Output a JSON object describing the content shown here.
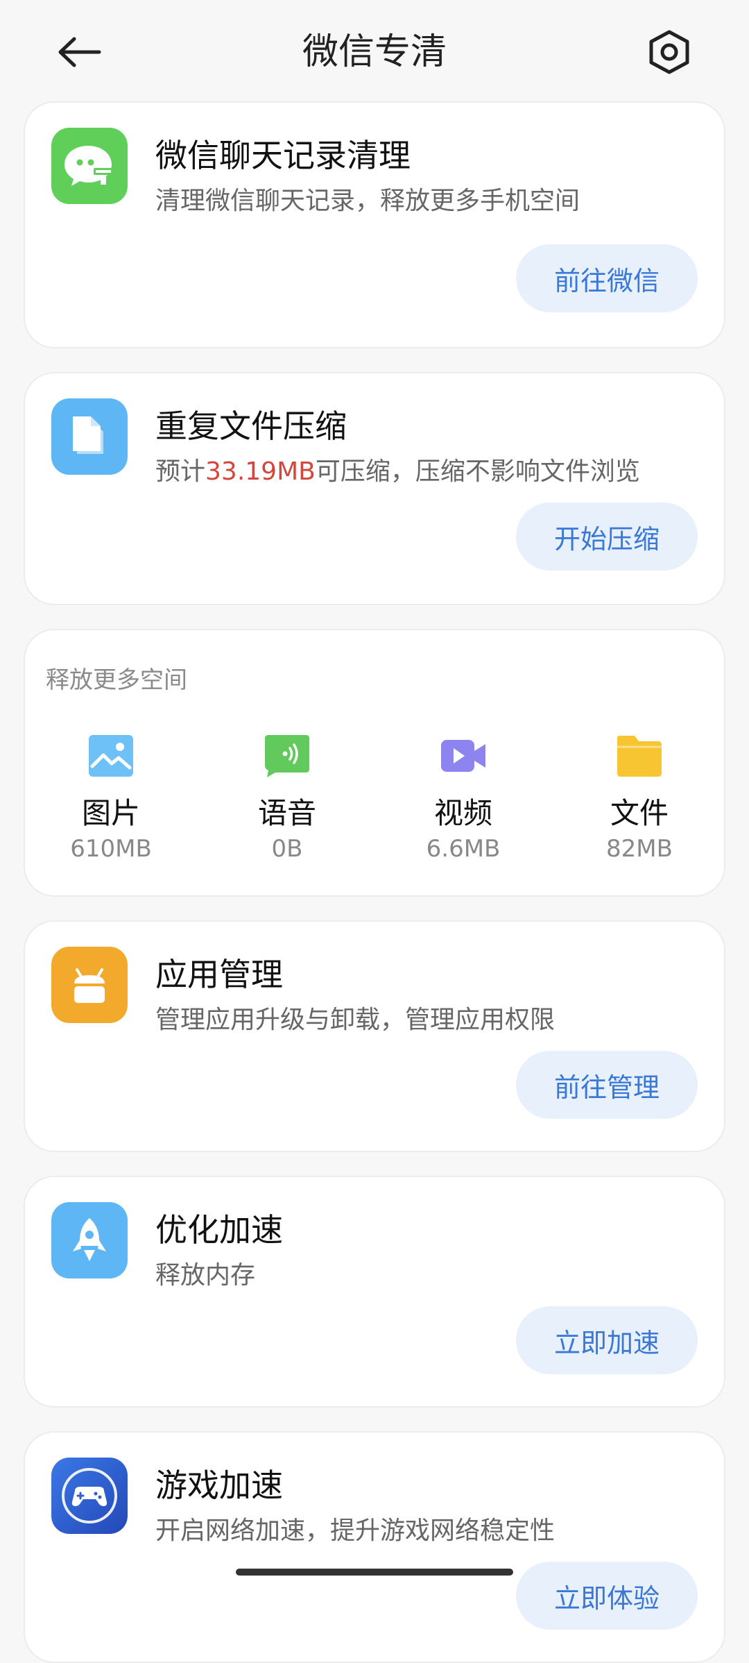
{
  "header": {
    "title": "微信专清",
    "back_icon": "arrow-left-icon",
    "settings_icon": "gear-hexagon-icon"
  },
  "cards": {
    "wechat": {
      "icon": "wechat-chat-icon",
      "title": "微信聊天记录清理",
      "subtitle": "清理微信聊天记录，释放更多手机空间",
      "button": "前往微信"
    },
    "compress": {
      "icon": "document-icon",
      "title": "重复文件压缩",
      "subtitle_prefix": "预计",
      "subtitle_highlight": "33.19MB",
      "subtitle_suffix": "可压缩，压缩不影响文件浏览",
      "button": "开始压缩"
    },
    "app_manage": {
      "icon": "android-app-icon",
      "title": "应用管理",
      "subtitle": "管理应用升级与卸载，管理应用权限",
      "button": "前往管理"
    },
    "speed_up": {
      "icon": "rocket-icon",
      "title": "优化加速",
      "subtitle": "释放内存",
      "button": "立即加速"
    },
    "game_speed": {
      "icon": "gamepad-icon",
      "title": "游戏加速",
      "subtitle": "开启网络加速，提升游戏网络稳定性",
      "button": "立即体验"
    }
  },
  "space": {
    "heading": "释放更多空间",
    "items": [
      {
        "label": "图片",
        "size": "610MB",
        "icon": "image-icon"
      },
      {
        "label": "语音",
        "size": "0B",
        "icon": "voice-message-icon"
      },
      {
        "label": "视频",
        "size": "6.6MB",
        "icon": "video-icon"
      },
      {
        "label": "文件",
        "size": "82MB",
        "icon": "folder-icon"
      }
    ]
  },
  "colors": {
    "accent": "#3a78d8",
    "button_bg": "#e8f0fc",
    "highlight": "#d2463c",
    "wechat_icon": "#5fcf5a",
    "doc_icon": "#5fb6f5",
    "app_icon": "#f3aa2c",
    "rocket_icon": "#5fb6f5",
    "game_icon": "#2e5fcf"
  }
}
